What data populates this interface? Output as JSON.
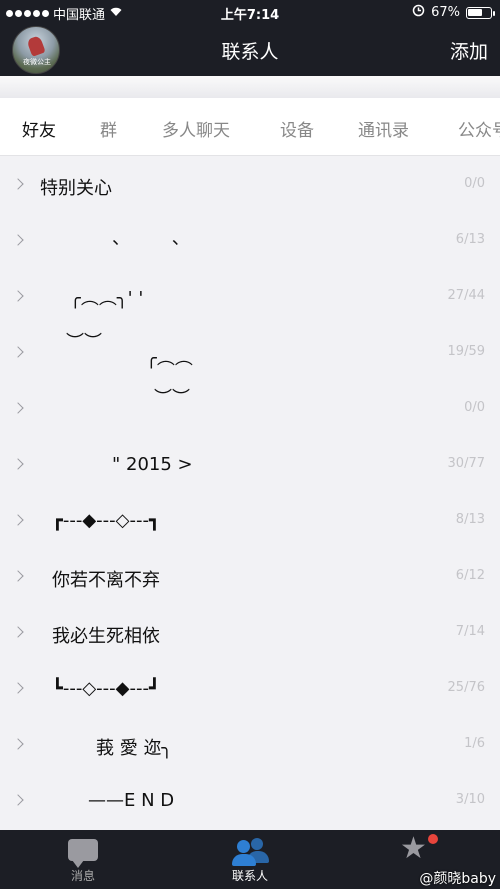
{
  "status_bar": {
    "carrier": "中国联通",
    "time": "上午7:14",
    "battery": "67%",
    "battery_level": 0.67
  },
  "nav": {
    "avatar_caption": "夜微公主",
    "title": "联系人",
    "add": "添加"
  },
  "tabs": [
    {
      "label": "好友",
      "active": true
    },
    {
      "label": "群"
    },
    {
      "label": "多人聊天"
    },
    {
      "label": "设备"
    },
    {
      "label": "通讯录"
    },
    {
      "label": "公众号"
    }
  ],
  "groups": [
    {
      "label": "特别关心",
      "count": "0/0"
    },
    {
      "label": "、 、",
      "count": "6/13"
    },
    {
      "label": "╭︵︵╮' '",
      "count": "27/44"
    },
    {
      "label": "︶︶",
      "count": "19/59"
    },
    {
      "label": "╭︵︵",
      "count": "0/0"
    },
    {
      "label": "︶︶",
      "count": "0/0"
    },
    {
      "label": "\" 2015 >",
      "count": "30/77"
    },
    {
      "label": "┏---◆---◇---┓",
      "count": "8/13"
    },
    {
      "label": "你若不离不弃",
      "count": "6/12"
    },
    {
      "label": "我必生死相依",
      "count": "7/14"
    },
    {
      "label": "┗---◇---◆---┛",
      "count": "25/76"
    },
    {
      "label": "莪 愛 迩╮",
      "count": "1/6"
    },
    {
      "label": "——E N D",
      "count": "3/10"
    }
  ],
  "tabbar": [
    {
      "label": "消息",
      "icon": "chat-bubble-icon"
    },
    {
      "label": "联系人",
      "icon": "contacts-icon",
      "active": true
    },
    {
      "label": "",
      "icon": "star-icon",
      "badge": true
    }
  ],
  "watermark": "@颜晓baby",
  "colors": {
    "header_bg": "#1c1e25",
    "active_blue": "#2e7fd3",
    "badge_red": "#e8453c"
  }
}
